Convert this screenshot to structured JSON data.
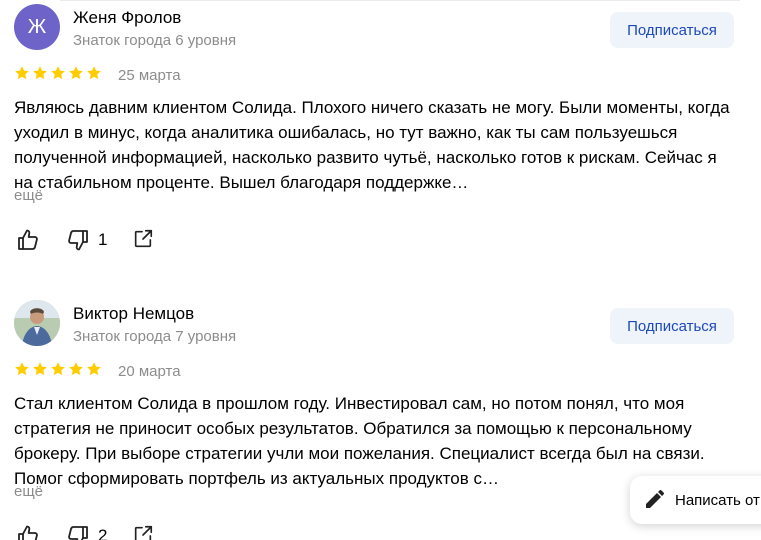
{
  "reviews": [
    {
      "author": "Женя Фролов",
      "avatar_letter": "Ж",
      "level": "Знаток города 6 уровня",
      "subscribe_label": "Подписаться",
      "rating": 5,
      "date": "25 марта",
      "text": "Являюсь давним клиентом Солида. Плохого ничего сказать не могу. Были моменты, когда уходил в минус, когда аналитика ошибалась, но тут важно, как ты сам пользуешься полученной информацией, насколько развито чутьё, насколько готов к рискам. Сейчас я на стабильном проценте. Вышел благодаря поддержке…",
      "more_label": "ещё",
      "dislikes": "1"
    },
    {
      "author": "Виктор Немцов",
      "level": "Знаток города 7 уровня",
      "subscribe_label": "Подписаться",
      "rating": 5,
      "date": "20 марта",
      "text": "Стал клиентом Солида в прошлом году. Инвестировал сам, но потом понял, что моя стратегия не приносит особых результатов. Обратился за помощью к персональному брокеру. При выборе стратегии учли мои пожелания. Специалист всегда был на связи. Помог сформировать портфель из актуальных продуктов с…",
      "more_label": "ещё",
      "dislikes": "2"
    }
  ],
  "write_review_label": "Написать от",
  "icons": {
    "star": "star-icon",
    "like": "thumb-up-icon",
    "dislike": "thumb-down-icon",
    "share": "share-icon",
    "pen": "pen-icon"
  },
  "colors": {
    "star": "#fc0",
    "link": "#1d4ab7",
    "button_bg": "#eff3fa",
    "avatar_bg": "#6e63c9",
    "secondary_text": "#8c8c8c"
  }
}
